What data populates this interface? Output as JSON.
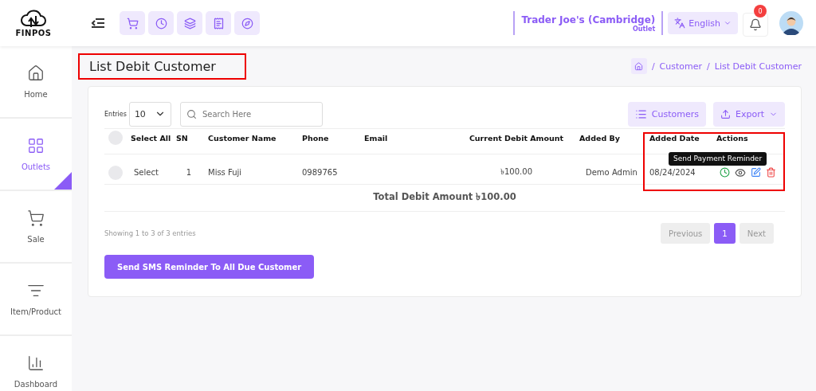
{
  "brand": {
    "logo_text": "FINPOS"
  },
  "header": {
    "store": {
      "name": "Trader Joe's (Cambridge)",
      "type": "Outlet"
    },
    "language": "English",
    "notifications": "0"
  },
  "sidebar": {
    "items": [
      {
        "label": "Home",
        "selected": false
      },
      {
        "label": "Outlets",
        "selected": true
      },
      {
        "label": "Sale",
        "selected": false
      },
      {
        "label": "Item/Product",
        "selected": false
      },
      {
        "label": "Dashboard",
        "selected": false
      }
    ]
  },
  "page": {
    "title": "List Debit Customer",
    "title_highlighted": true,
    "breadcrumb": [
      {
        "separator": "/",
        "label": "Customer"
      },
      {
        "separator": "/",
        "label": "List Debit Customer"
      }
    ]
  },
  "toolbar": {
    "entries_label": "Entries",
    "entries_value": "10",
    "search_placeholder": "Search Here",
    "customers_button": "Customers",
    "export_button": "Export"
  },
  "table": {
    "columns": [
      "Select All",
      "SN",
      "Customer Name",
      "Phone",
      "Email",
      "Current Debit Amount",
      "Added By",
      "Added Date",
      "Actions"
    ],
    "actions_highlighted": true,
    "select_all_checked": false,
    "rows": [
      {
        "select": "Select",
        "checked": false,
        "sn": "1",
        "name": "Miss Fuji",
        "phone": "0989765",
        "amount": "৳100.00",
        "added_by": "Demo Admin",
        "added_date": "08/24/2024"
      }
    ],
    "tooltip": "Send Payment Reminder",
    "total": "Total Debit Amount ৳100.00"
  },
  "footer": {
    "showing": "Showing 1 to 3 of 3 entries",
    "pages": [
      {
        "label": "Previous",
        "selected": false,
        "disabled": true
      },
      {
        "label": "1",
        "selected": true,
        "disabled": false
      },
      {
        "label": "Next",
        "selected": false,
        "disabled": true
      }
    ],
    "sms_button": "Send SMS Reminder To All Due Customer"
  }
}
